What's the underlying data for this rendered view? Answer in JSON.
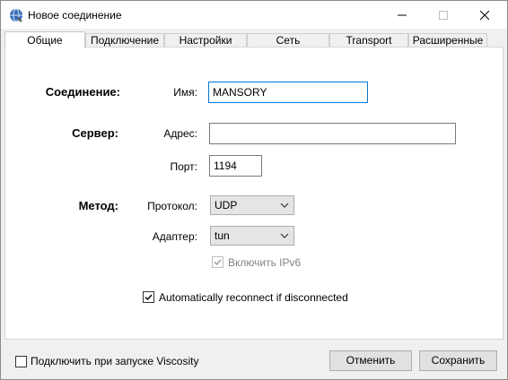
{
  "window": {
    "title": "Новое соединение"
  },
  "tabs": [
    {
      "label": "Общие",
      "active": true
    },
    {
      "label": "Подключение"
    },
    {
      "label": "Настройки"
    },
    {
      "label": "Сеть"
    },
    {
      "label": "Transport"
    },
    {
      "label": "Расширенные"
    }
  ],
  "connection": {
    "section_label": "Соединение:",
    "name_label": "Имя:",
    "name_value": "MANSORY"
  },
  "server": {
    "section_label": "Сервер:",
    "address_label": "Адрес:",
    "address_value": "",
    "port_label": "Порт:",
    "port_value": "1194"
  },
  "method": {
    "section_label": "Метод:",
    "protocol_label": "Протокол:",
    "protocol_value": "UDP",
    "adapter_label": "Адаптер:",
    "adapter_value": "tun",
    "ipv6_label": "Включить IPv6",
    "ipv6_checked": true
  },
  "reconnect": {
    "label": "Automatically reconnect if disconnected",
    "checked": true
  },
  "footer": {
    "startup_label": "Подключить при запуске Viscosity",
    "startup_checked": false,
    "cancel_label": "Отменить",
    "save_label": "Сохранить"
  },
  "colors": {
    "focus_border": "#0078d7",
    "tab_active_bg": "#ffffff",
    "dialog_bg": "#f0f0f0"
  }
}
